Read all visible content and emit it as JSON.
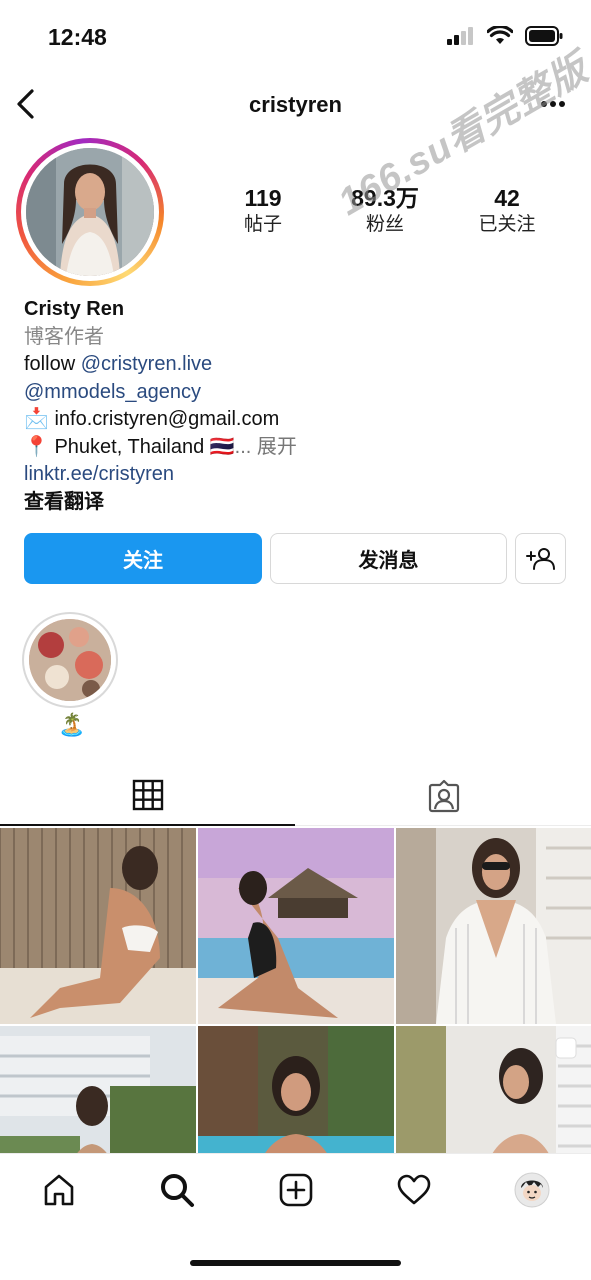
{
  "status_bar": {
    "time": "12:48"
  },
  "header": {
    "username": "cristyren"
  },
  "profile": {
    "stats": [
      {
        "value": "119",
        "label": "帖子"
      },
      {
        "value": "89.3万",
        "label": "粉丝"
      },
      {
        "value": "42",
        "label": "已关注"
      }
    ],
    "name": "Cristy Ren",
    "category": "博客作者",
    "bio": {
      "line1_prefix": "follow ",
      "line1_link": "@cristyren.live",
      "line2_link": "@mmodels_agency",
      "line3_emoji": "📩",
      "line3_text": " info.cristyren@gmail.com",
      "line4_emoji": "📍",
      "line4_text": " Phuket, Thailand 🇹🇭",
      "line4_more": "... 展开",
      "website": "linktr.ee/cristyren",
      "translate": "查看翻译"
    }
  },
  "watermark": "166.su看完整版",
  "actions": {
    "follow": "关注",
    "message": "发消息"
  },
  "highlights": [
    {
      "label": "🏝️"
    }
  ],
  "tabs": [
    {
      "icon": "grid-icon"
    },
    {
      "icon": "tagged-icon"
    }
  ],
  "posts": [
    {
      "colors": [
        "#c9b8a0",
        "#8e6e55",
        "#f1ece6"
      ]
    },
    {
      "colors": [
        "#c8a6d8",
        "#6fb2d6",
        "#e9e0da"
      ]
    },
    {
      "colors": [
        "#dcd7cf",
        "#9a8f83",
        "#f4f2ee"
      ]
    },
    {
      "colors": [
        "#dde3e8",
        "#6f8f5e",
        "#c9b7a5"
      ]
    },
    {
      "colors": [
        "#6f6a4f",
        "#48b7cf",
        "#1f1d1b"
      ]
    },
    {
      "colors": [
        "#e5e3df",
        "#8f8f8f",
        "#f5f5f5"
      ]
    }
  ],
  "bottom_nav": [
    {
      "icon": "home-icon"
    },
    {
      "icon": "search-icon"
    },
    {
      "icon": "new-post-icon"
    },
    {
      "icon": "activity-heart-icon"
    },
    {
      "icon": "profile-avatar-icon"
    }
  ],
  "colors": {
    "follow_button": "#1a97f0",
    "link": "#2a4a7f"
  }
}
